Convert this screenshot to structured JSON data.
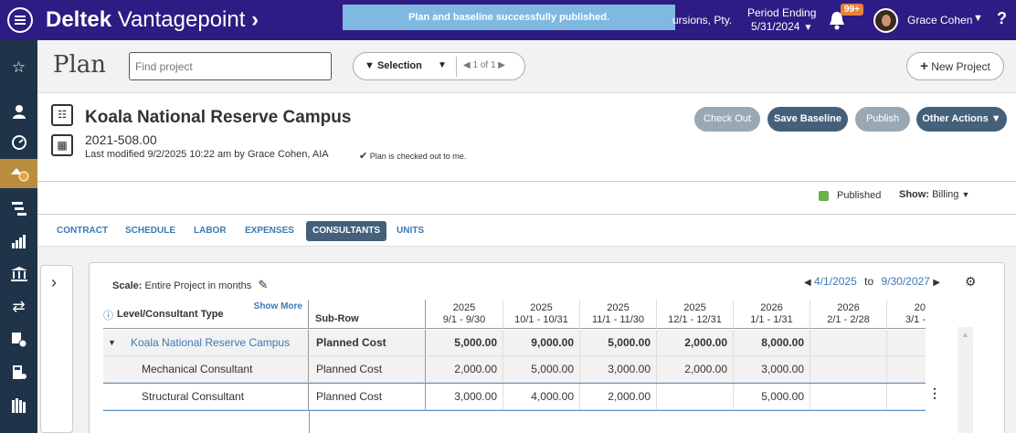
{
  "topbar": {
    "brand_bold": "Deltek",
    "brand_rest": " Vantagepoint",
    "brand_chevron": "›",
    "toast": "Plan and baseline successfully published.",
    "company": "ursions, Pty.",
    "period_label": "Period Ending",
    "period_date": "5/31/2024",
    "notif_badge": "99+",
    "user": "Grace Cohen",
    "help": "?"
  },
  "header": {
    "title": "Plan",
    "search_placeholder": "Find project",
    "selection_label": "Selection",
    "pager": "1 of 1",
    "new_project": "New Project"
  },
  "project": {
    "name": "Koala National Reserve Campus",
    "number": "2021-508.00",
    "last_modified": "Last modified 9/2/2025 10:22 am by Grace Cohen, AIA",
    "checked_out": "Plan is checked out to me.",
    "actions": {
      "check_out": "Check Out",
      "save_baseline": "Save Baseline",
      "publish": "Publish",
      "other": "Other Actions"
    },
    "status": "Published",
    "show_label": "Show:",
    "show_value": "Billing"
  },
  "tabs": [
    "CONTRACT",
    "SCHEDULE",
    "LABOR",
    "EXPENSES",
    "CONSULTANTS",
    "UNITS"
  ],
  "active_tab": "CONSULTANTS",
  "grid": {
    "scale_label": "Scale:",
    "scale_value": "Entire Project in months",
    "range_start": "4/1/2025",
    "range_to": "to",
    "range_end": "9/30/2027",
    "col_level": "Level/Consultant Type",
    "show_more": "Show More",
    "col_subrow": "Sub-Row",
    "periods": [
      {
        "year": "2025",
        "range": "9/1 - 9/30"
      },
      {
        "year": "2025",
        "range": "10/1 - 10/31"
      },
      {
        "year": "2025",
        "range": "11/1 - 11/30"
      },
      {
        "year": "2025",
        "range": "12/1 - 12/31"
      },
      {
        "year": "2026",
        "range": "1/1 - 1/31"
      },
      {
        "year": "2026",
        "range": "2/1 - 2/28"
      },
      {
        "year": "20",
        "range": "3/1 -"
      }
    ],
    "rows": [
      {
        "name": "Koala National Reserve Campus",
        "sub": "Planned Cost",
        "values": [
          "5,000.00",
          "9,000.00",
          "5,000.00",
          "2,000.00",
          "8,000.00",
          "",
          ""
        ]
      },
      {
        "name": "Mechanical Consultant",
        "sub": "Planned Cost",
        "values": [
          "2,000.00",
          "5,000.00",
          "3,000.00",
          "2,000.00",
          "3,000.00",
          "",
          ""
        ]
      },
      {
        "name": "Structural Consultant",
        "sub": "Planned Cost",
        "values": [
          "3,000.00",
          "4,000.00",
          "2,000.00",
          "",
          "5,000.00",
          "",
          ""
        ]
      }
    ]
  },
  "colors": {
    "topbar": "#2f1b84",
    "leftnav": "#1f3448",
    "active_nav": "#b88e3e",
    "primary_button": "#44607a",
    "link": "#3a7ab5",
    "toast": "#7fb8e0"
  }
}
